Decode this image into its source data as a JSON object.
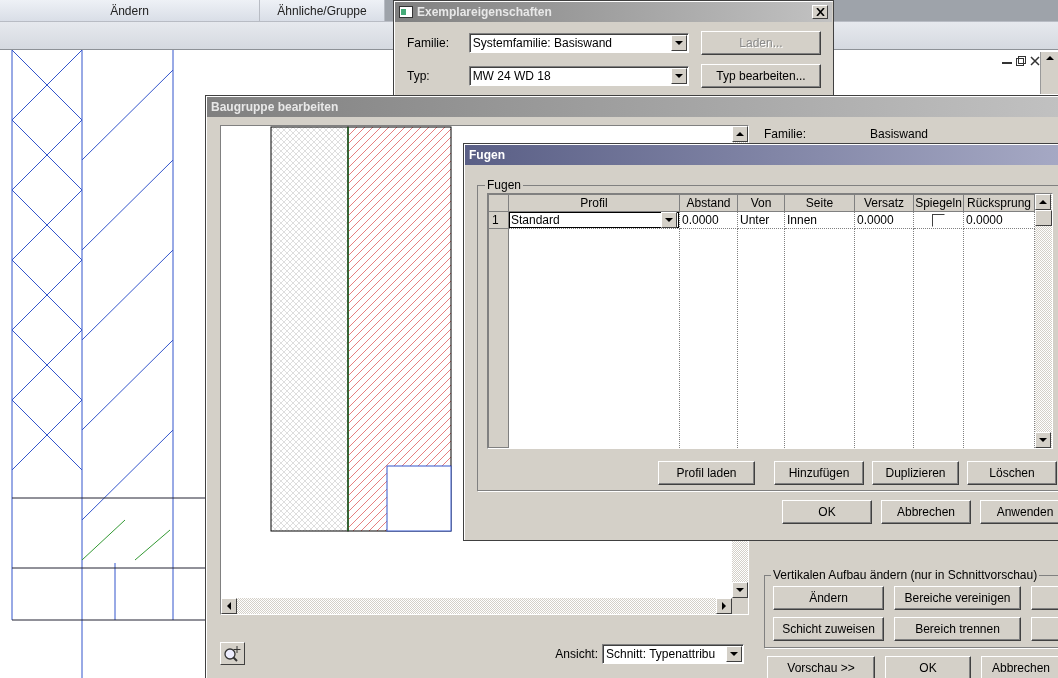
{
  "ribbon": {
    "panels": [
      "Ändern",
      "Ähnliche/Gruppe"
    ]
  },
  "instance_properties": {
    "title": "Exemplareigenschaften",
    "active": false,
    "fields": [
      {
        "label": "Familie:",
        "value": "Systemfamilie: Basiswand",
        "button": "Laden...",
        "disabled": true
      },
      {
        "label": "Typ:",
        "value": "MW 24 WD 18",
        "button": "Typ bearbeiten...",
        "disabled": false
      }
    ]
  },
  "assembly_editor": {
    "title": "Baugruppe bearbeiten",
    "active": false,
    "properties": [
      {
        "label": "Familie:",
        "value": "Basiswand"
      }
    ],
    "view": {
      "label": "Ansicht:",
      "value": "Schnitt: Typenattribu"
    },
    "vertical_group": {
      "title": "Vertikalen Aufbau ändern (nur in Schnittvorschau)",
      "rows": [
        [
          "Ändern",
          "Bereiche vereinigen"
        ],
        [
          "Schicht zuweisen",
          "Bereich trennen"
        ]
      ]
    },
    "buttons": [
      "Vorschau >>",
      "OK",
      "Abbrechen"
    ]
  },
  "joints_dialog": {
    "title": "Fugen",
    "active": true,
    "group_title": "Fugen",
    "table": {
      "columns": [
        "Profil",
        "Abstand",
        "Von",
        "Seite",
        "Versatz",
        "Spiegeln",
        "Rücksprung"
      ],
      "rows": [
        {
          "number": "1",
          "profil": "Standard",
          "abstand": "0.0000",
          "von": "Unter",
          "seite": "Innen",
          "versatz": "0.0000",
          "spiegeln": false,
          "ruecksprung": "0.0000"
        }
      ]
    },
    "buttons": [
      "Profil laden",
      "Hinzufügen",
      "Duplizieren",
      "Löschen"
    ],
    "footer_buttons": [
      "OK",
      "Abbrechen",
      "Anwenden"
    ]
  }
}
